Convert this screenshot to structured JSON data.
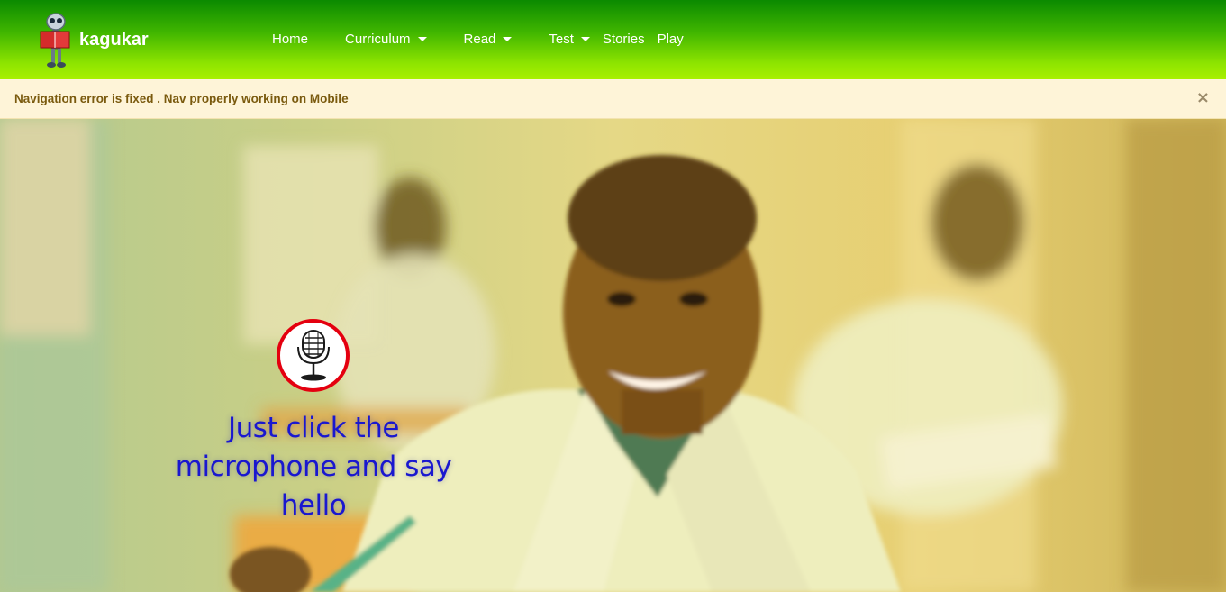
{
  "brand": {
    "name": "kagukar",
    "logo_icon": "robot-reading-icon"
  },
  "nav": {
    "items": [
      {
        "label": "Home",
        "dropdown": false
      },
      {
        "label": "Curriculum",
        "dropdown": true
      },
      {
        "label": "Read",
        "dropdown": true
      },
      {
        "label": "Test",
        "dropdown": true
      },
      {
        "label": "Stories",
        "dropdown": false
      },
      {
        "label": "Play",
        "dropdown": false
      }
    ]
  },
  "alert": {
    "message": "Navigation error is fixed . Nav properly working on Mobile",
    "close_symbol": "×"
  },
  "hero": {
    "mic_icon": "microphone-icon",
    "caption": "Just click the microphone and say hello"
  },
  "colors": {
    "nav_top": "#0b8a00",
    "nav_bottom": "#a8f000",
    "alert_bg": "#fef4d8",
    "alert_text": "#7a5a0e",
    "mic_ring": "#e4000f",
    "caption": "#1a17cf"
  }
}
